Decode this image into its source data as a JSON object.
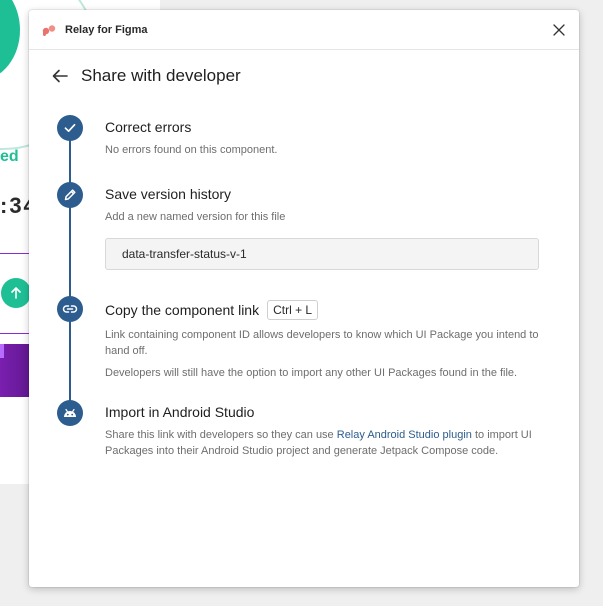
{
  "background": {
    "status_fragment": "ed",
    "digits_fragment": ":34"
  },
  "window": {
    "app_title": "Relay for Figma"
  },
  "header": {
    "title": "Share with developer"
  },
  "steps": [
    {
      "title": "Correct errors",
      "description": "No errors found on this component.",
      "icon": "check-icon"
    },
    {
      "title": "Save version history",
      "description": "Add a new named version for this file",
      "input_value": "data-transfer-status-v-1",
      "icon": "pencil-icon"
    },
    {
      "title": "Copy the component link",
      "shortcut": "Ctrl + L",
      "description_1": "Link containing component ID allows developers to know which UI Package you intend to hand off.",
      "description_2": "Developers will still have the option to import any other UI Packages found in the file.",
      "icon": "link-icon"
    },
    {
      "title": "Import in Android Studio",
      "description_before": "Share this link with developers so they can use ",
      "link_text": "Relay Android Studio plugin",
      "description_after": " to import UI Packages into their Android Studio project and generate Jetpack Compose code.",
      "icon": "android-icon"
    }
  ],
  "colors": {
    "accent": "#2d5c8e",
    "canvas_green": "#1fbf96",
    "canvas_purple": "#7a1fb0"
  }
}
